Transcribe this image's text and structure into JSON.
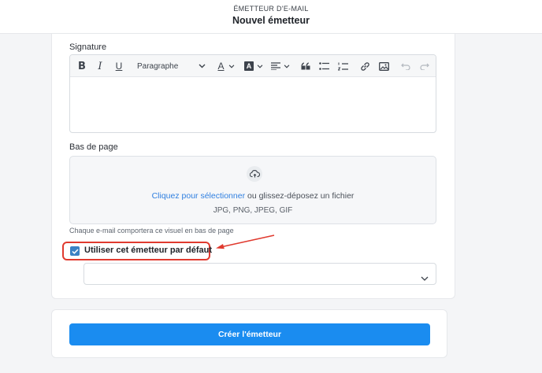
{
  "header": {
    "subtitle": "ÉMETTEUR D'E-MAIL",
    "title": "Nouvel émetteur"
  },
  "signature": {
    "label": "Signature",
    "toolbar": {
      "bold": "B",
      "italic": "I",
      "underline": "U",
      "paragraph": "Paragraphe",
      "text_color": "A",
      "highlight": "A",
      "icons": [
        "bold-icon",
        "italic-icon",
        "underline-icon",
        "paragraph-dropdown",
        "text-color-icon",
        "highlight-icon",
        "align-icon",
        "quote-icon",
        "bullet-list-icon",
        "numbered-list-icon",
        "link-icon",
        "image-icon",
        "undo-icon",
        "redo-icon"
      ]
    }
  },
  "footer": {
    "label": "Bas de page",
    "link_text": "Cliquez pour sélectionner",
    "drop_text": " ou glissez-déposez un fichier",
    "types": "JPG, PNG, JPEG, GIF",
    "hint": "Chaque e-mail comportera ce visuel en bas de page"
  },
  "default_sender": {
    "label": "Utiliser cet émetteur par défaut",
    "checked": true
  },
  "select": {
    "value": ""
  },
  "actions": {
    "create_label": "Créer l'émetteur"
  },
  "colors": {
    "primary": "#1a8cf0",
    "link": "#2f7fe0",
    "highlight_box": "#e03a2f",
    "checkbox": "#3b82c4"
  }
}
